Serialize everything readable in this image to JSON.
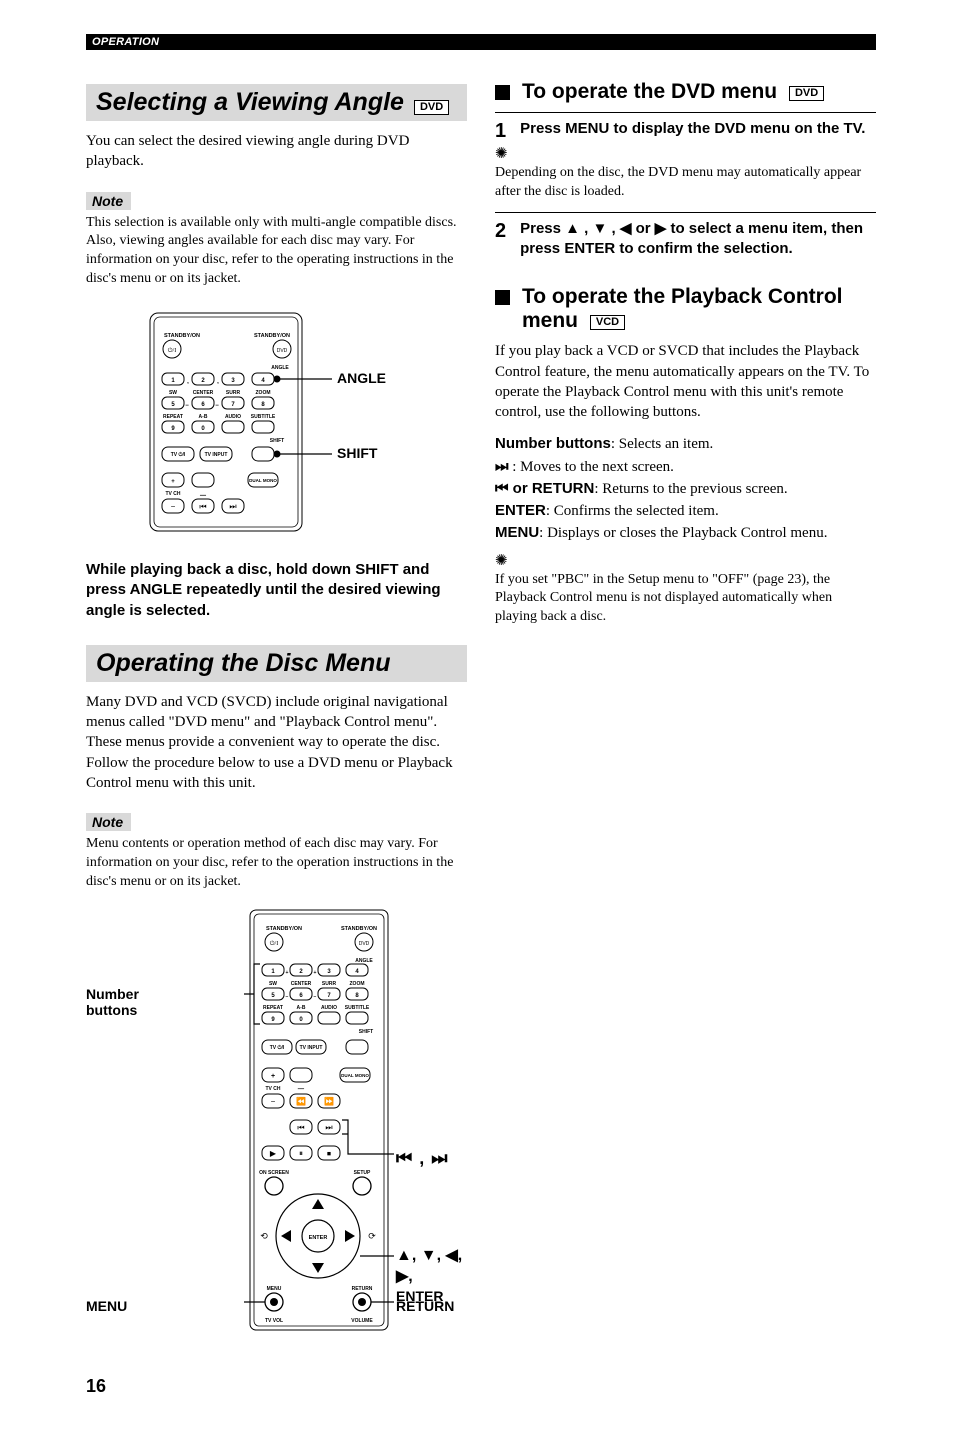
{
  "header": {
    "section": "OPERATION"
  },
  "page_number": "16",
  "left": {
    "h1_title": "Selecting a Viewing Angle",
    "h1_badge": "DVD",
    "intro": "You can select the desired viewing angle during DVD playback.",
    "note_label": "Note",
    "note_text": "This selection is available only with multi-angle compatible discs. Also, viewing angles available for each disc may vary. For information on your disc, refer to the operating instructions in the disc's menu or on its jacket.",
    "fig1_labels": {
      "angle": "ANGLE",
      "shift": "SHIFT"
    },
    "instruction": "While playing back a disc, hold down SHIFT and press ANGLE repeatedly until the desired viewing angle is selected.",
    "h2_title": "Operating the Disc Menu",
    "h2_intro": "Many DVD and VCD (SVCD) include original navigational menus called \"DVD menu\" and \"Playback Control menu\". These menus provide a convenient way to operate the disc. Follow the procedure below to use a DVD menu or Playback Control menu with this unit.",
    "note2_label": "Note",
    "note2_text": "Menu contents or operation method of each disc may vary. For information on your disc, refer to the operation instructions in the disc's menu or on its jacket.",
    "fig2_labels": {
      "number_buttons": "Number buttons",
      "menu": "MENU",
      "skip": "⏮ , ⏭",
      "arrows_enter": "▲, ▼, ◀, ▶, ENTER",
      "return": "RETURN"
    }
  },
  "right": {
    "sub1_title": "To operate the DVD menu",
    "sub1_badge": "DVD",
    "step1_num": "1",
    "step1_text": "Press MENU to display the DVD menu on the TV.",
    "tip1": "Depending on the disc, the DVD menu may automatically appear after the disc is loaded.",
    "step2_num": "2",
    "step2_text_a": "Press ",
    "step2_text_b": " to select a menu item, then press ENTER to confirm the selection.",
    "arrows_seq": "▲ , ▼ , ◀ or ▶",
    "sub2_title": "To operate the Playback Control menu",
    "sub2_badge": "VCD",
    "sub2_intro": "If you play back a VCD or SVCD that includes the Playback Control feature, the menu automatically appears on the TV. To operate the Playback Control menu with this unit's remote control, use the following buttons.",
    "defs": {
      "number_label": "Number buttons",
      "number_text": ": Selects an item.",
      "next_icon": "⏭",
      "next_text": " : Moves to the next screen.",
      "prev_icon": "⏮",
      "prev_label": " or RETURN",
      "prev_text": ": Returns to the previous screen.",
      "enter_label": "ENTER",
      "enter_text": ": Confirms the selected item.",
      "menu_label": "MENU",
      "menu_text": ": Displays or closes the Playback Control menu."
    },
    "tip2": "If you set \"PBC\" in the Setup menu to \"OFF\" (page 23), the Playback Control menu is not displayed automatically when playing back a disc."
  },
  "remote": {
    "row_labels_top": [
      "STANDBY/ON",
      "STANDBY/ON",
      "DVD"
    ],
    "num_row1": [
      "1",
      "2",
      "3",
      "4"
    ],
    "angle_small": "ANGLE",
    "mid_row_labels": [
      "SW",
      "CENTER",
      "SURR",
      "ZOOM"
    ],
    "num_row2": [
      "5",
      "6",
      "7",
      "8"
    ],
    "row3_labels": [
      "REPEAT",
      "A-B",
      "AUDIO",
      "SUBTITLE"
    ],
    "num_row3": [
      "9",
      "0"
    ],
    "shift_small": "SHIFT",
    "tv_row": [
      "TV ⏻/I",
      "TV INPUT"
    ],
    "plus": "+",
    "minus": "−",
    "tvch": "TV CH",
    "dualmono": "DUAL MONO",
    "bottom_labels": [
      "ON SCREEN",
      "SETUP",
      "ENTER",
      "MENU",
      "RETURN",
      "TV VOL",
      "VOLUME"
    ],
    "play": "▶",
    "pause": "⏸",
    "stop": "⏹",
    "rew": "⏪",
    "ff": "⏩",
    "skipb": "⏮",
    "skipf": "⏭"
  }
}
